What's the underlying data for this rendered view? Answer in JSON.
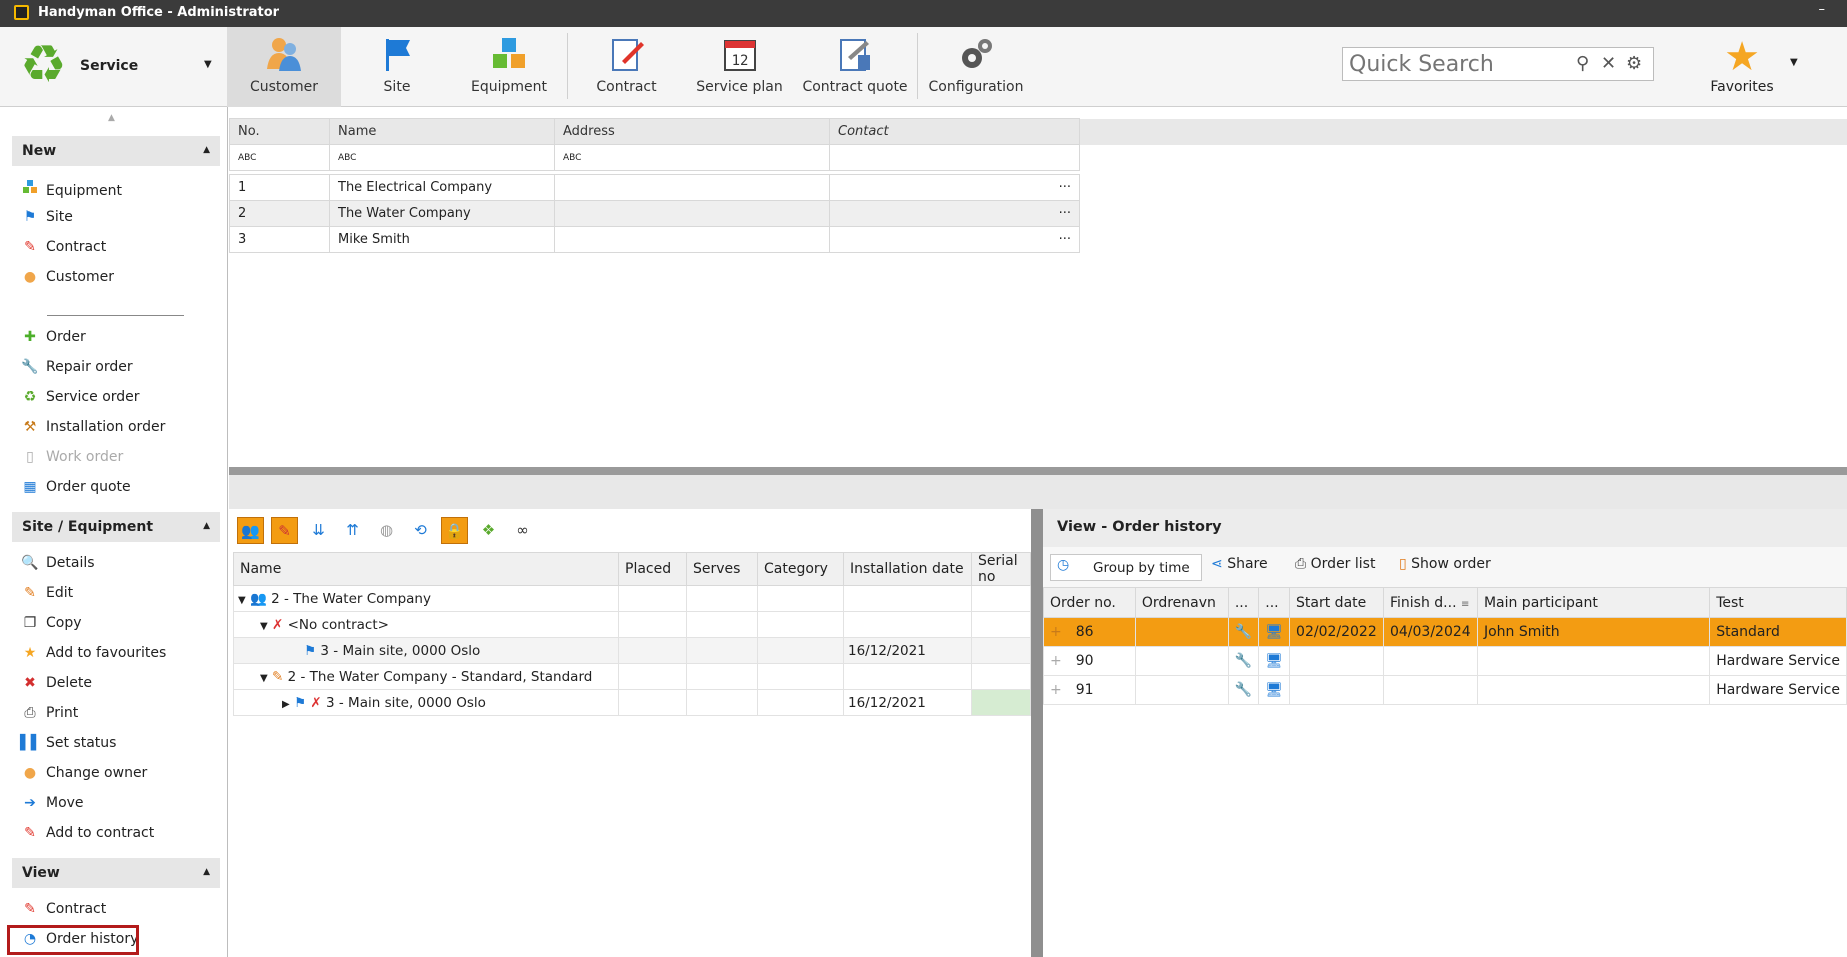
{
  "window": {
    "title": "Handyman Office - Administrator",
    "minimize": "–"
  },
  "ribbon": {
    "module": "Service",
    "tabs": [
      {
        "label": "Customer",
        "icon": "customer-icon"
      },
      {
        "label": "Site",
        "icon": "flag-icon"
      },
      {
        "label": "Equipment",
        "icon": "equipment-icon"
      },
      {
        "label": "Contract",
        "icon": "contract-icon"
      },
      {
        "label": "Service plan",
        "icon": "calendar-icon"
      },
      {
        "label": "Contract quote",
        "icon": "contract-quote-icon"
      },
      {
        "label": "Configuration",
        "icon": "gear-icon"
      }
    ],
    "calendar_day": "12",
    "search_placeholder": "Quick Search",
    "favorites": "Favorites"
  },
  "sidebar": {
    "new_header": "New",
    "new_items": [
      {
        "label": "Equipment",
        "icon": "equipment-icon"
      },
      {
        "label": "Site",
        "icon": "flag-icon"
      },
      {
        "label": "Contract",
        "icon": "contract-icon"
      },
      {
        "label": "Customer",
        "icon": "customer-icon"
      },
      {
        "label": "Order",
        "icon": "plus-icon"
      },
      {
        "label": "Repair order",
        "icon": "wrench-icon"
      },
      {
        "label": "Service order",
        "icon": "service-icon"
      },
      {
        "label": "Installation order",
        "icon": "hammer-icon"
      },
      {
        "label": "Work order",
        "icon": "clipboard-icon"
      },
      {
        "label": "Order quote",
        "icon": "calculator-icon"
      }
    ],
    "site_header": "Site / Equipment",
    "site_items": [
      {
        "label": "Details",
        "icon": "search-icon"
      },
      {
        "label": "Edit",
        "icon": "edit-icon"
      },
      {
        "label": "Copy",
        "icon": "copy-icon"
      },
      {
        "label": "Add to favourites",
        "icon": "star-icon"
      },
      {
        "label": "Delete",
        "icon": "delete-icon"
      },
      {
        "label": "Print",
        "icon": "print-icon"
      },
      {
        "label": "Set status",
        "icon": "status-icon"
      },
      {
        "label": "Change owner",
        "icon": "person-icon"
      },
      {
        "label": "Move",
        "icon": "move-icon"
      },
      {
        "label": "Add to contract",
        "icon": "contract-icon"
      }
    ],
    "view_header": "View",
    "view_items": [
      {
        "label": "Contract",
        "icon": "contract-icon"
      },
      {
        "label": "Order history",
        "icon": "order-history-icon"
      }
    ]
  },
  "customers": {
    "columns": [
      "No.",
      "Name",
      "Address",
      "Contact"
    ],
    "filter": "ABC",
    "more": "···",
    "rows": [
      {
        "no": "1",
        "name": "The Electrical Company",
        "address": "",
        "contact": ""
      },
      {
        "no": "2",
        "name": "The Water Company",
        "address": "",
        "contact": ""
      },
      {
        "no": "3",
        "name": "Mike Smith",
        "address": "",
        "contact": ""
      }
    ]
  },
  "tree": {
    "columns": [
      "Name",
      "Placed",
      "Serves",
      "Category",
      "Installation date",
      "Serial no"
    ],
    "rows": [
      {
        "indent": 0,
        "arrow": "▼",
        "name": "2 - The Water Company",
        "date": ""
      },
      {
        "indent": 1,
        "arrow": "▼",
        "name": "<No contract>",
        "date": ""
      },
      {
        "indent": 2,
        "arrow": "",
        "name": "3 - Main site, 0000 Oslo",
        "date": "16/12/2021"
      },
      {
        "indent": 1,
        "arrow": "▼",
        "name": "2 - The Water Company  - Standard, Standard",
        "date": ""
      },
      {
        "indent": 2,
        "arrow": "▶",
        "name": "3 - Main site, 0000 Oslo",
        "date": "16/12/2021"
      }
    ]
  },
  "order_history": {
    "title": "View - Order history",
    "group_by": "Group by time",
    "share": "Share",
    "order_list": "Order list",
    "show_order": "Show order",
    "columns": [
      "Order no.",
      "Ordrenavn",
      "...",
      "...",
      "Start date",
      "Finish d...",
      "Main participant",
      "Test"
    ],
    "rows": [
      {
        "no": "86",
        "name": "",
        "start": "02/02/2022",
        "finish": "04/03/2024",
        "participant": "John Smith",
        "test": "Standard",
        "selected": true
      },
      {
        "no": "90",
        "name": "",
        "start": "",
        "finish": "",
        "participant": "",
        "test": "Hardware Service",
        "selected": false
      },
      {
        "no": "91",
        "name": "",
        "start": "",
        "finish": "",
        "participant": "",
        "test": "Hardware Service",
        "selected": false
      }
    ]
  }
}
